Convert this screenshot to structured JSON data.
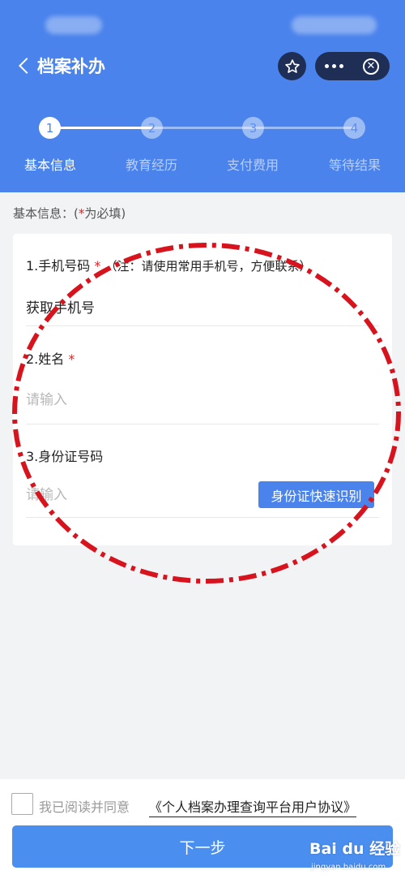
{
  "nav": {
    "title": "档案补办",
    "back_icon": "chevron-left-icon",
    "favorite_icon": "star-icon",
    "more_icon": "more-dots-icon",
    "close_icon": "close-circle-icon"
  },
  "steps": [
    {
      "number": "1",
      "label": "基本信息",
      "status": "done"
    },
    {
      "number": "2",
      "label": "教育经历",
      "status": "todo"
    },
    {
      "number": "3",
      "label": "支付费用",
      "status": "todo"
    },
    {
      "number": "4",
      "label": "等待结果",
      "status": "todo"
    }
  ],
  "form": {
    "section_prefix": "基本信息：(",
    "section_req": "*",
    "section_suffix": "为必填)",
    "phone": {
      "label": "1.手机号码",
      "req": "*",
      "note": "（注：请使用常用手机号，方便联系）",
      "value": "获取手机号"
    },
    "name": {
      "label": "2.姓名",
      "req": "*",
      "placeholder": "请输入"
    },
    "id_card": {
      "label": "3.身份证号码",
      "placeholder": "请输入",
      "button": "身份证快速识别"
    }
  },
  "footer": {
    "agree_text": "我已阅读并同意",
    "agreement_link": "《个人档案办理查询平台用户协议》",
    "next_button": "下一步"
  },
  "watermark": {
    "main": "Bai du 经验",
    "sub": "jingyan.baidu.com"
  },
  "colors": {
    "header": "#4a83ec",
    "primary_button": "#4a8ef0",
    "required": "#e02424",
    "annotation": "#d7141e"
  }
}
